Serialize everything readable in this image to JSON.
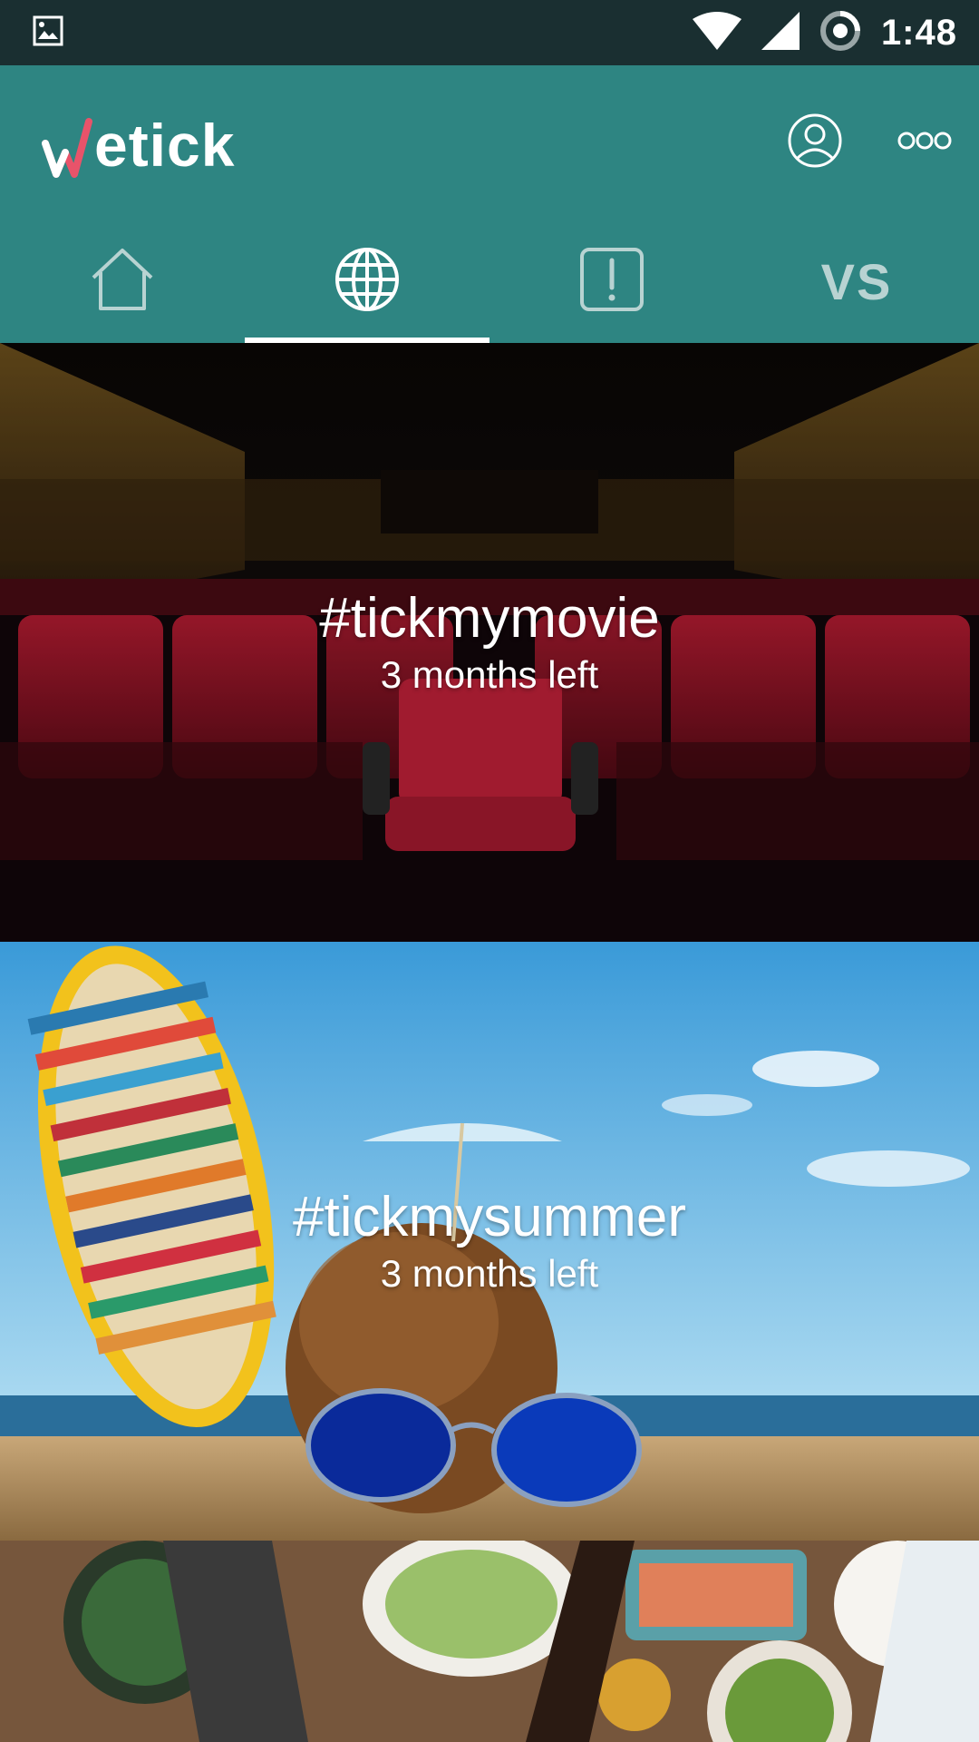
{
  "status_bar": {
    "time": "1:48",
    "icons": [
      "image-notification-icon",
      "wifi-icon",
      "cell-signal-icon",
      "sync-icon"
    ]
  },
  "app": {
    "logo_text": "etick",
    "logo_w": "w",
    "header_icons": [
      "profile-icon",
      "more-icon"
    ]
  },
  "tabs": [
    {
      "name": "home",
      "icon": "home-icon"
    },
    {
      "name": "explore",
      "icon": "globe-icon",
      "selected": true
    },
    {
      "name": "alerts",
      "icon": "alert-icon"
    },
    {
      "name": "versus",
      "label": "VS"
    }
  ],
  "cards": [
    {
      "title": "#tickmymovie",
      "subtitle": "3 months left"
    },
    {
      "title": "#tickmysummer",
      "subtitle": "3 months left"
    },
    {
      "title": "",
      "subtitle": ""
    }
  ],
  "colors": {
    "status_bar": "#1a2f31",
    "app_bar": "#2e8582",
    "logo_accent": "#e8536a",
    "tab_inactive": "#b8d3d2"
  }
}
